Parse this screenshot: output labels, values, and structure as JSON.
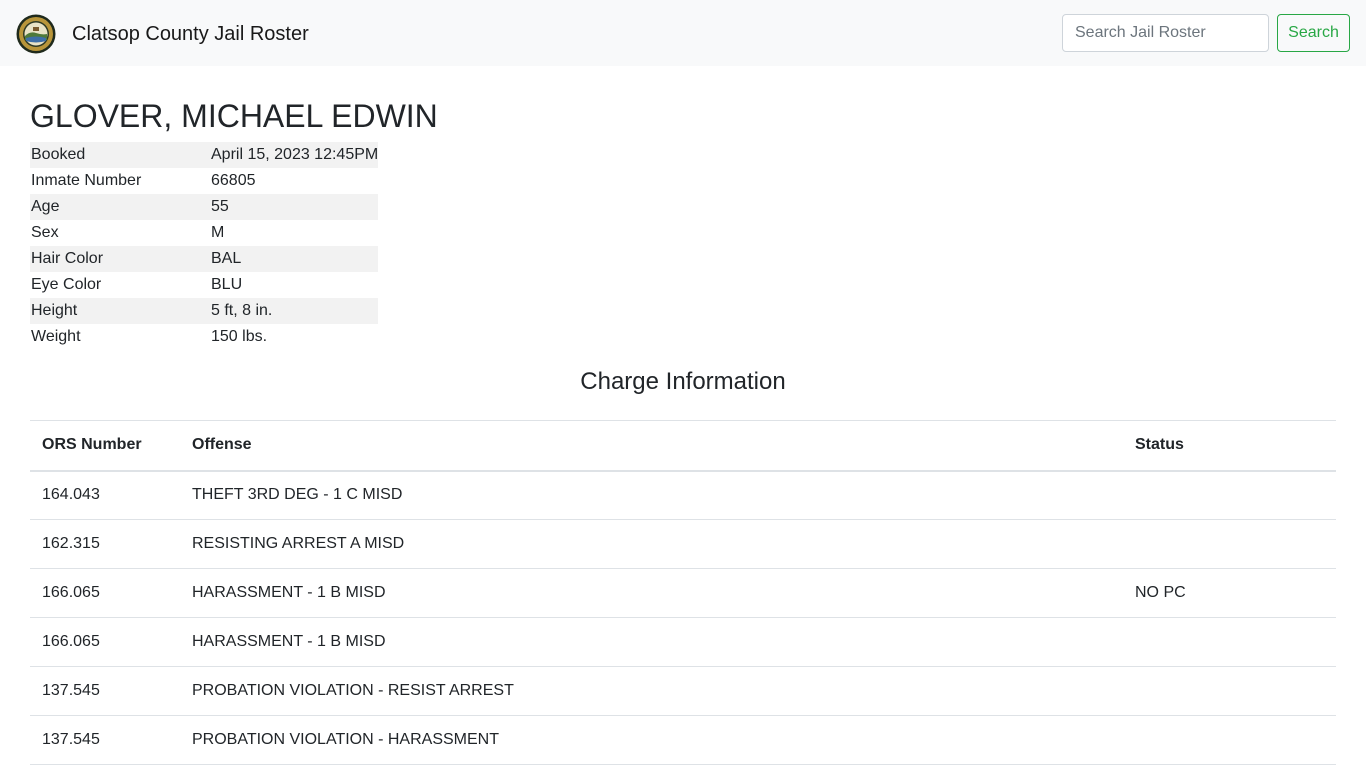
{
  "header": {
    "site_title": "Clatsop County Jail Roster",
    "search_placeholder": "Search Jail Roster",
    "search_button": "Search"
  },
  "inmate": {
    "name": "GLOVER, MICHAEL EDWIN",
    "details": [
      {
        "label": "Booked",
        "value": "April 15, 2023 12:45PM"
      },
      {
        "label": "Inmate Number",
        "value": "66805"
      },
      {
        "label": "Age",
        "value": "55"
      },
      {
        "label": "Sex",
        "value": "M"
      },
      {
        "label": "Hair Color",
        "value": "BAL"
      },
      {
        "label": "Eye Color",
        "value": "BLU"
      },
      {
        "label": "Height",
        "value": "5 ft, 8 in."
      },
      {
        "label": "Weight",
        "value": "150 lbs."
      }
    ]
  },
  "charges": {
    "title": "Charge Information",
    "columns": [
      "ORS Number",
      "Offense",
      "Status"
    ],
    "rows": [
      {
        "ors": "164.043",
        "offense": "THEFT 3RD DEG - 1 C MISD",
        "status": ""
      },
      {
        "ors": "162.315",
        "offense": "RESISTING ARREST A MISD",
        "status": ""
      },
      {
        "ors": "166.065",
        "offense": "HARASSMENT - 1 B MISD",
        "status": "NO PC"
      },
      {
        "ors": "166.065",
        "offense": "HARASSMENT - 1 B MISD",
        "status": ""
      },
      {
        "ors": "137.545",
        "offense": "PROBATION VIOLATION - RESIST ARREST",
        "status": ""
      },
      {
        "ors": "137.545",
        "offense": "PROBATION VIOLATION - HARASSMENT",
        "status": ""
      }
    ]
  },
  "colors": {
    "navbar_bg": "#f8f9fa",
    "success": "#28a745",
    "stripe": "#f2f2f2",
    "border": "#dee2e6",
    "seal_gold": "#b8953a",
    "seal_dark": "#1f2a1c"
  },
  "icons": {
    "logo": "county-seal-icon"
  }
}
